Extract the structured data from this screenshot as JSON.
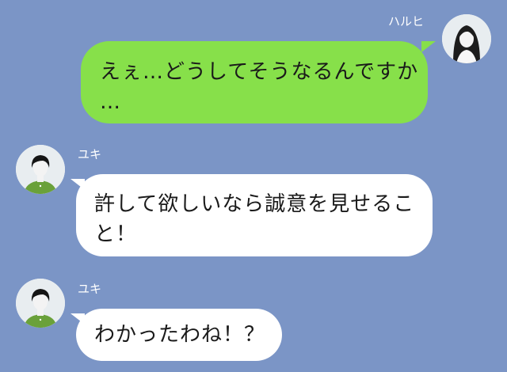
{
  "messages": [
    {
      "side": "right",
      "sender": "ハルヒ",
      "text": "えぇ…どうしてそうなるんですか\n…",
      "avatar_icon": "woman-avatar-icon"
    },
    {
      "side": "left",
      "sender": "ユキ",
      "text": "許して欲しいなら誠意を見せるこ\nと！",
      "avatar_icon": "man-avatar-icon"
    },
    {
      "side": "left",
      "sender": "ユキ",
      "text": "わかったわね！？",
      "avatar_icon": "man-avatar-icon"
    }
  ],
  "colors": {
    "background": "#7b95c6",
    "sent_bubble": "#87e04a",
    "received_bubble": "#ffffff",
    "sender_name": "#ffffff"
  }
}
